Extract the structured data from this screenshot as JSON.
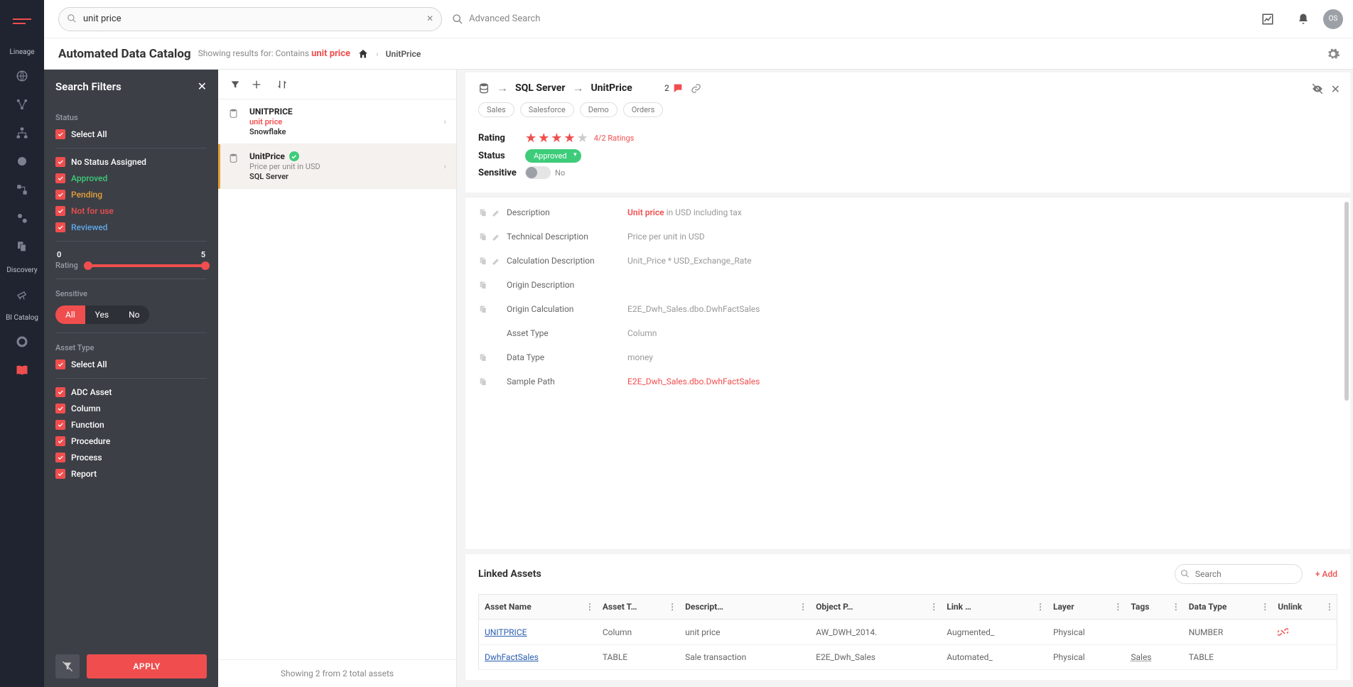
{
  "nav": {
    "sections": [
      "Lineage",
      "Discovery",
      "BI Catalog"
    ]
  },
  "topbar": {
    "search_value": "unit price",
    "advanced": "Advanced Search",
    "avatar": "OS"
  },
  "subhead": {
    "title": "Automated Data Catalog",
    "results_prefix": "Showing results for: Contains",
    "term": "unit price",
    "crumb": "UnitPrice"
  },
  "filters": {
    "title": "Search Filters",
    "status_label": "Status",
    "select_all": "Select All",
    "statuses": [
      "No Status Assigned",
      "Approved",
      "Pending",
      "Not for use",
      "Reviewed"
    ],
    "rating_label": "Rating",
    "rating_min": "0",
    "rating_max": "5",
    "sensitive_label": "Sensitive",
    "seg": [
      "All",
      "Yes",
      "No"
    ],
    "asset_type_label": "Asset Type",
    "asset_types": [
      "ADC Asset",
      "Column",
      "Function",
      "Procedure",
      "Process",
      "Report"
    ],
    "apply": "APPLY"
  },
  "results": {
    "items": [
      {
        "title": "UNITPRICE",
        "sub1": "unit price",
        "sub2": "Snowflake",
        "approved": false
      },
      {
        "title": "UnitPrice",
        "sub1": "Price per unit in USD",
        "sub2": "SQL Server",
        "approved": true
      }
    ],
    "footer": "Showing 2 from 2 total assets"
  },
  "detail": {
    "db": "SQL Server",
    "asset": "UnitPrice",
    "comment_count": "2",
    "tags": [
      "Sales",
      "Salesforce",
      "Demo",
      "Orders"
    ],
    "rating_label": "Rating",
    "rating_text": "4/2 Ratings",
    "status_label": "Status",
    "status_value": "Approved",
    "sensitive_label": "Sensitive",
    "sensitive_value": "No",
    "props": [
      {
        "label": "Description",
        "value_hl": "Unit price",
        "value": " in USD including tax",
        "edit": true
      },
      {
        "label": "Technical Description",
        "value": "Price per unit in USD",
        "edit": true
      },
      {
        "label": "Calculation Description",
        "value": "Unit_Price * USD_Exchange_Rate",
        "edit": true
      },
      {
        "label": "Origin Description",
        "value": "",
        "edit": false
      },
      {
        "label": "Origin Calculation",
        "value": "E2E_Dwh_Sales.dbo.DwhFactSales",
        "edit": false
      },
      {
        "label": "Asset Type",
        "value": "Column",
        "edit": false,
        "nocopy": true
      },
      {
        "label": "Data Type",
        "value": "money",
        "edit": false
      },
      {
        "label": "Sample Path",
        "value": "E2E_Dwh_Sales.dbo.DwhFactSales",
        "edit": false,
        "link": true
      }
    ],
    "linked_title": "Linked Assets",
    "linked_search_ph": "Search",
    "add": "+ Add",
    "columns": [
      "Asset Name",
      "Asset T…",
      "Descript…",
      "Object P…",
      "Link …",
      "Layer",
      "Tags",
      "Data Type",
      "Unlink"
    ],
    "rows": [
      {
        "name": "UNITPRICE",
        "type": "Column",
        "desc": "unit price",
        "obj": "AW_DWH_2014.",
        "link": "Augmented_",
        "layer": "Physical",
        "tags": "",
        "dt": "NUMBER",
        "unlink": true
      },
      {
        "name": "DwhFactSales",
        "type": "TABLE",
        "desc": "Sale transaction",
        "obj": "E2E_Dwh_Sales",
        "link": "Automated_",
        "layer": "Physical",
        "tags": "Sales",
        "dt": "TABLE",
        "unlink": false
      }
    ]
  }
}
